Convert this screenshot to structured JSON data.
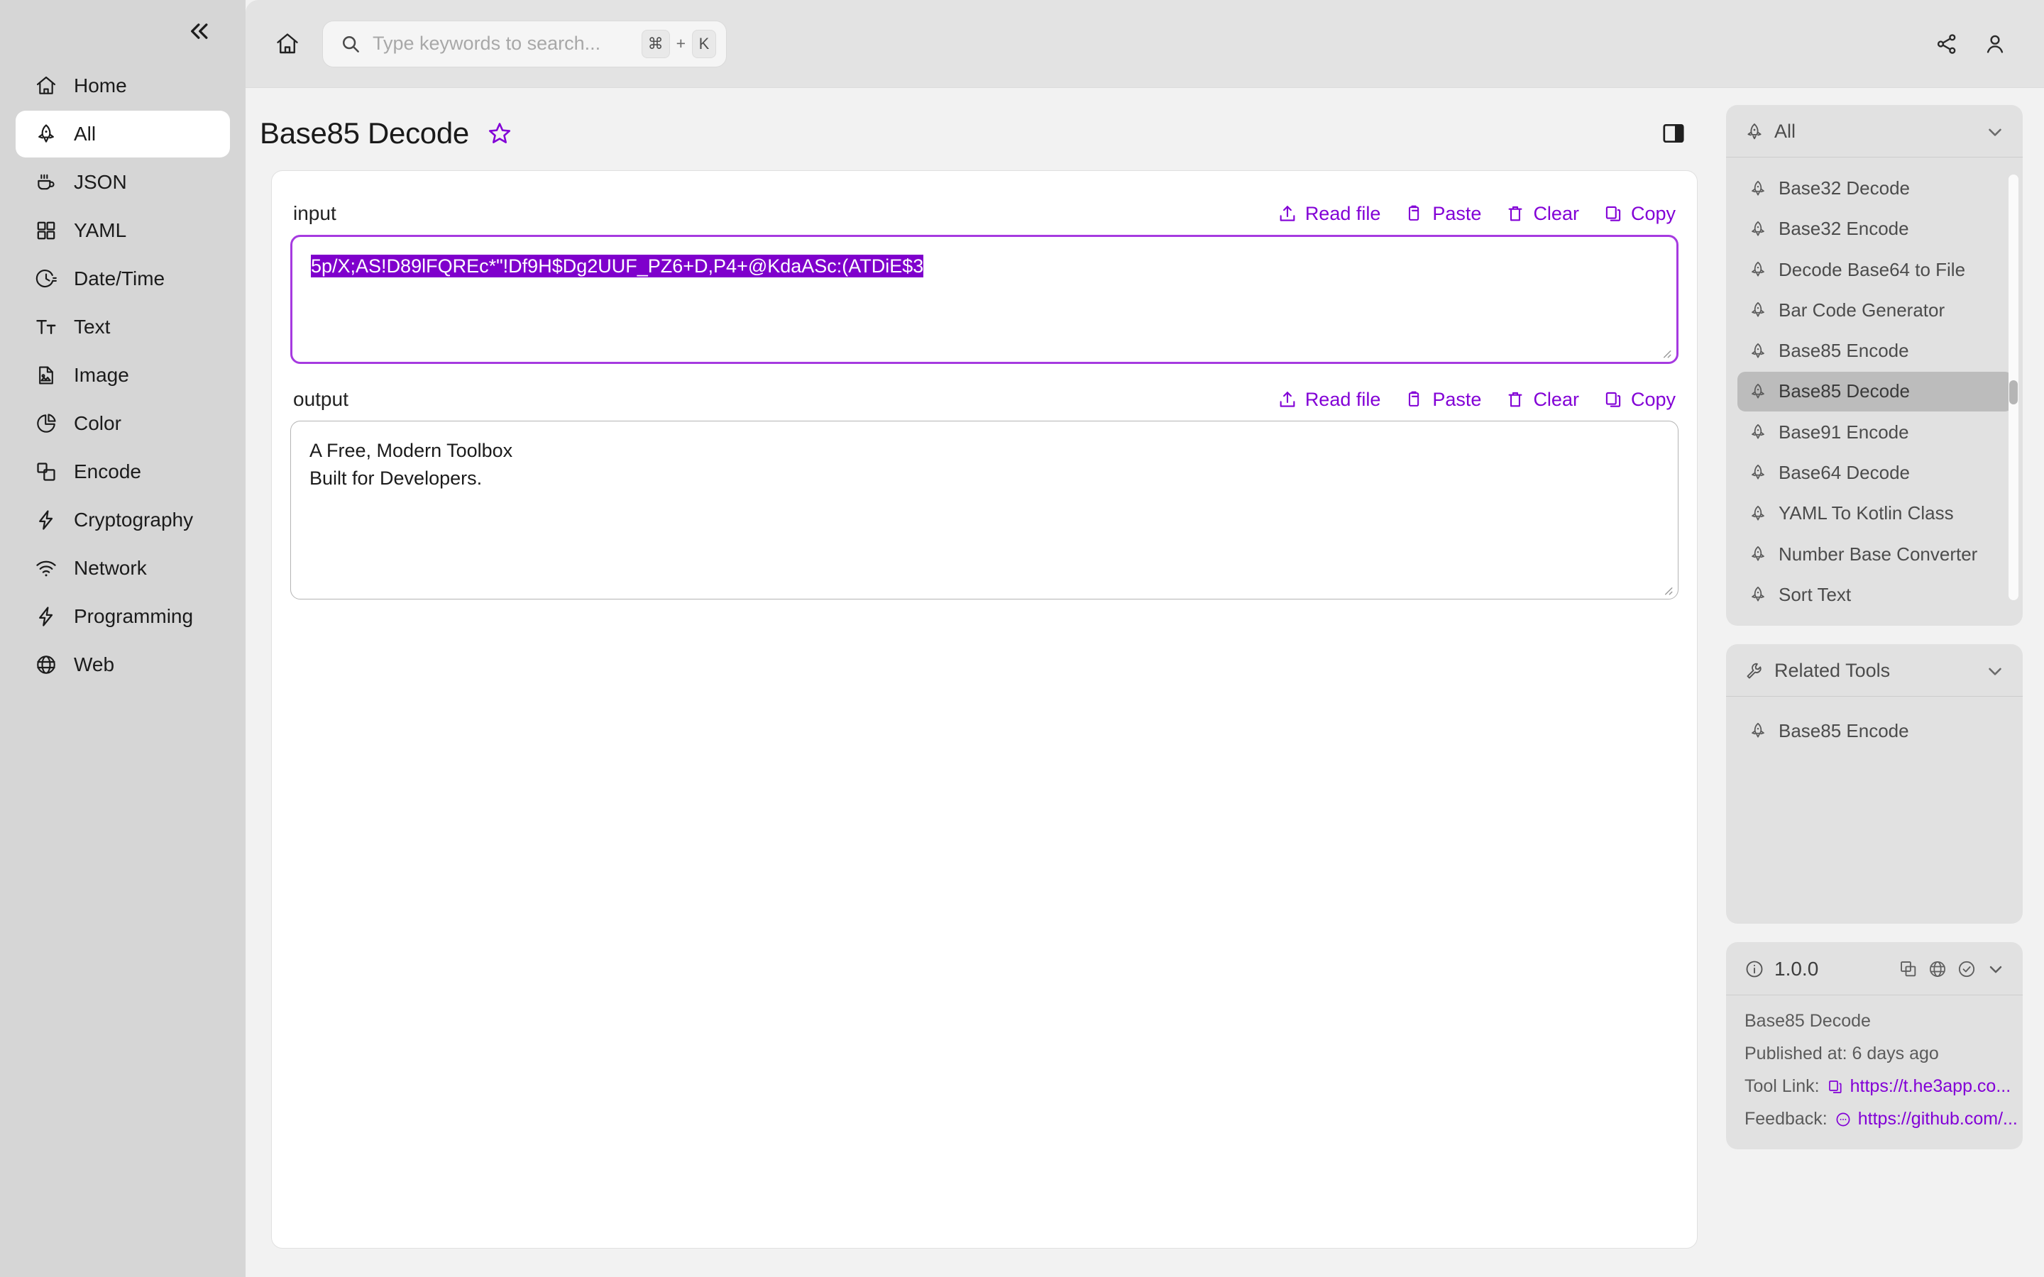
{
  "sidebar": {
    "collapse_label": "«",
    "items": [
      {
        "label": "Home",
        "icon": "home-icon"
      },
      {
        "label": "All",
        "icon": "rocket-icon"
      },
      {
        "label": "JSON",
        "icon": "coffee-cup-icon"
      },
      {
        "label": "YAML",
        "icon": "grid-icon"
      },
      {
        "label": "Date/Time",
        "icon": "clock-icon"
      },
      {
        "label": "Text",
        "icon": "typography-icon"
      },
      {
        "label": "Image",
        "icon": "image-file-icon"
      },
      {
        "label": "Color",
        "icon": "pie-chart-icon"
      },
      {
        "label": "Encode",
        "icon": "layers-icon"
      },
      {
        "label": "Cryptography",
        "icon": "lightning-icon"
      },
      {
        "label": "Network",
        "icon": "wifi-icon"
      },
      {
        "label": "Programming",
        "icon": "lightning-icon"
      },
      {
        "label": "Web",
        "icon": "globe-icon"
      }
    ],
    "active": "All"
  },
  "topbar": {
    "home_icon": "home-icon",
    "search": {
      "placeholder": "Type keywords to search...",
      "icon": "search-icon",
      "shortcut_key": "⌘",
      "shortcut_plus": "+",
      "shortcut_letter": "K"
    },
    "share_icon": "share-icon",
    "account_icon": "user-icon"
  },
  "page": {
    "title": "Base85 Decode",
    "favorite_icon": "star-icon",
    "panel_toggle_icon": "right-panel-toggle-icon"
  },
  "io": {
    "input": {
      "label": "input",
      "value": "5p/X;AS!D89lFQREc*\"!Df9H$Dg2UUF_PZ6+D,P4+@KdaASc:(ATDiE$3",
      "selected": true,
      "actions": [
        {
          "label": "Read file",
          "icon": "upload-icon"
        },
        {
          "label": "Paste",
          "icon": "clipboard-paste-icon"
        },
        {
          "label": "Clear",
          "icon": "trash-icon"
        },
        {
          "label": "Copy",
          "icon": "copy-icon"
        }
      ]
    },
    "output": {
      "label": "output",
      "lines": [
        "A Free, Modern Toolbox",
        "Built for Developers."
      ],
      "actions": [
        {
          "label": "Read file",
          "icon": "upload-icon"
        },
        {
          "label": "Paste",
          "icon": "clipboard-paste-icon"
        },
        {
          "label": "Clear",
          "icon": "trash-icon"
        },
        {
          "label": "Copy",
          "icon": "copy-icon"
        }
      ]
    }
  },
  "rail": {
    "all_panel": {
      "title": "All",
      "icon": "rocket-icon",
      "chevron": "chevron-down-icon",
      "items": [
        {
          "label": "Base32 Decode"
        },
        {
          "label": "Base32 Encode"
        },
        {
          "label": "Decode Base64 to File"
        },
        {
          "label": "Bar Code Generator"
        },
        {
          "label": "Base85 Encode"
        },
        {
          "label": "Base85 Decode"
        },
        {
          "label": "Base91 Encode"
        },
        {
          "label": "Base64 Decode"
        },
        {
          "label": "YAML To Kotlin Class"
        },
        {
          "label": "Number Base Converter"
        },
        {
          "label": "Sort Text"
        }
      ],
      "active": "Base85 Decode"
    },
    "related_panel": {
      "title": "Related Tools",
      "icon": "wrench-icon",
      "chevron": "chevron-down-icon",
      "items": [
        {
          "label": "Base85 Encode"
        }
      ]
    },
    "info_panel": {
      "icon": "info-icon",
      "version": "1.0.0",
      "head_icons": [
        "copy-icon",
        "globe-icon",
        "check-circle-icon",
        "chevron-down-icon"
      ],
      "tool_name": "Base85 Decode",
      "published": "Published at: 6 days ago",
      "tool_link_label": "Tool Link:",
      "tool_link_url": "https://t.he3app.co...",
      "tool_link_icon": "copy-icon",
      "feedback_label": "Feedback:",
      "feedback_url": "https://github.com/...",
      "feedback_icon": "chat-icon"
    }
  },
  "colors": {
    "accent": "#8200d6",
    "selection": "#7f00cc",
    "focus_border": "#a63ae0",
    "sidebar_bg": "#d6d6d6",
    "rail_panel_bg": "#e1e1e1"
  }
}
